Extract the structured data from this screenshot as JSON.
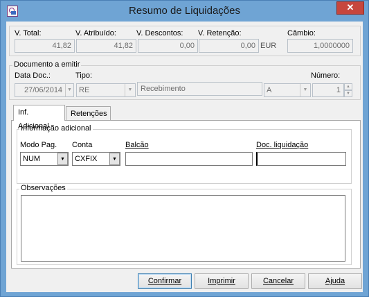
{
  "window": {
    "title": "Resumo de Liquidações",
    "close_symbol": "✕"
  },
  "totals": {
    "v_total_label": "V. Total:",
    "v_total_value": "41,82",
    "v_atribuido_label": "V. Atribuído:",
    "v_atribuido_value": "41,82",
    "v_descontos_label": "V. Descontos:",
    "v_descontos_value": "0,00",
    "v_retencao_label": "V. Retenção:",
    "v_retencao_value": "0,00",
    "currency": "EUR",
    "cambio_label": "Câmbio:",
    "cambio_value": "1,0000000"
  },
  "documento": {
    "group_title": "Documento a emitir",
    "data_label": "Data Doc.:",
    "data_value": "27/06/2014",
    "tipo_label": "Tipo:",
    "tipo_value": "RE",
    "tipo_desc": "Recebimento",
    "serie_value": "A",
    "numero_label": "Número:",
    "numero_value": "1"
  },
  "tabs": [
    {
      "label": "Inf. Adicional"
    },
    {
      "label": "Retenções"
    }
  ],
  "info_adicional": {
    "group_title": "Informação adicional",
    "modo_pag_label": "Modo Pag.",
    "modo_pag_value": "NUM",
    "conta_label": "Conta",
    "conta_value": "CXFIX",
    "balcao_label": "Balcão",
    "balcao_value": "",
    "doc_liq_label": "Doc. liquidação",
    "doc_liq_value": ""
  },
  "observacoes": {
    "group_title": "Observações",
    "value": ""
  },
  "buttons": {
    "confirmar": "Confirmar",
    "imprimir": "Imprimir",
    "cancelar": "Cancelar",
    "ajuda": "Ajuda"
  },
  "colors": {
    "titlebar": "#6fa4d4",
    "close": "#c7463d",
    "client": "#f0f0f0"
  }
}
